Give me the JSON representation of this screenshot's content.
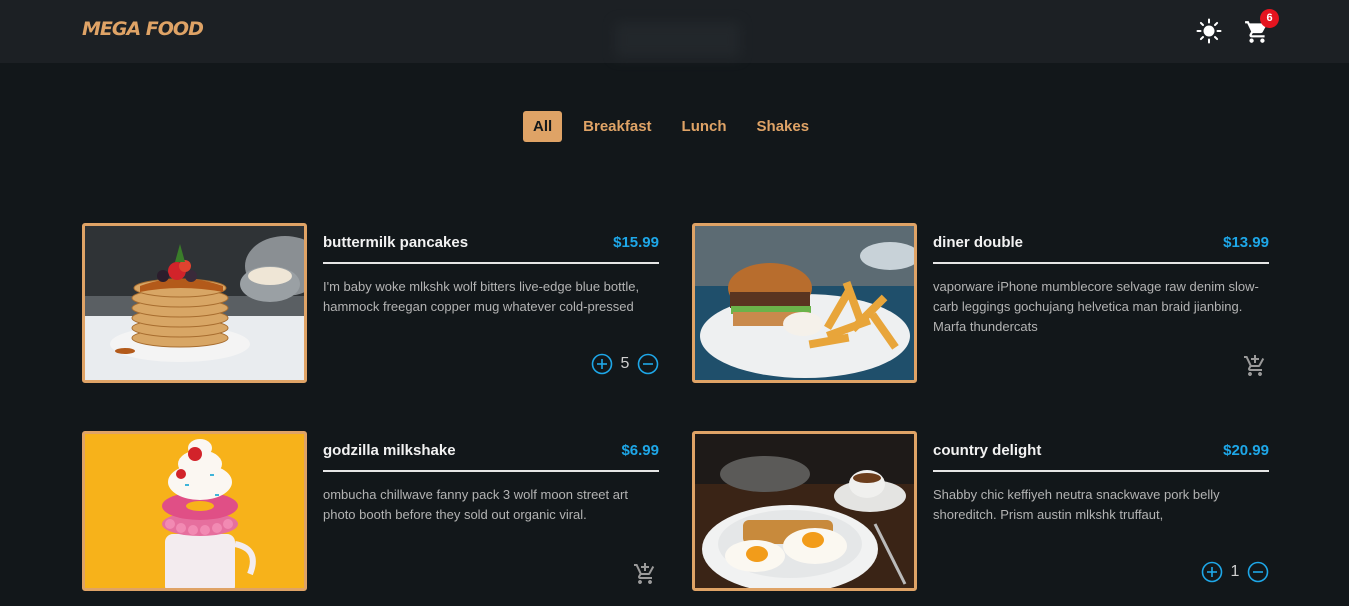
{
  "header": {
    "brand": "MEGA FOOD",
    "cart_count": "6",
    "theme_icon": "sun-icon",
    "cart_icon": "cart-icon"
  },
  "tabs": [
    {
      "label": "All",
      "active": true
    },
    {
      "label": "Breakfast",
      "active": false
    },
    {
      "label": "Lunch",
      "active": false
    },
    {
      "label": "Shakes",
      "active": false
    }
  ],
  "colors": {
    "accent": "#dfa366",
    "price": "#1ea7e8",
    "badge": "#e5141f",
    "background": "#12171a",
    "header": "#1c2024"
  },
  "items": [
    {
      "title": "buttermilk pancakes",
      "price": "$15.99",
      "description": "I'm baby woke mlkshk wolf bitters live-edge blue bottle, hammock freegan copper mug whatever cold-pressed",
      "quantity": "5",
      "image": "pancakes-photo"
    },
    {
      "title": "diner double",
      "price": "$13.99",
      "description": "vaporware iPhone mumblecore selvage raw denim slow-carb leggings gochujang helvetica man braid jianbing. Marfa thundercats",
      "quantity": null,
      "image": "burger-photo"
    },
    {
      "title": "godzilla milkshake",
      "price": "$6.99",
      "description": "ombucha chillwave fanny pack 3 wolf moon street art photo booth before they sold out organic viral.",
      "quantity": null,
      "image": "milkshake-photo"
    },
    {
      "title": "country delight",
      "price": "$20.99",
      "description": "Shabby chic keffiyeh neutra snackwave pork belly shoreditch. Prism austin mlkshk truffaut,",
      "quantity": "1",
      "image": "breakfast-plate-photo"
    }
  ]
}
